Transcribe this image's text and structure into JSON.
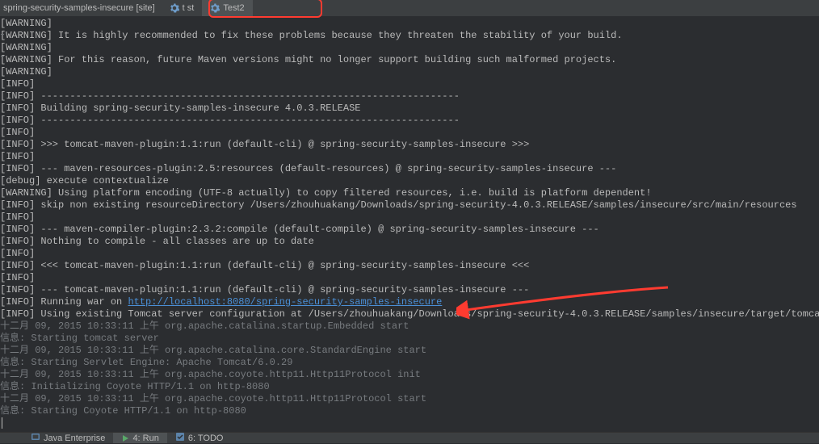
{
  "topbar": {
    "config_label": "spring-security-samples-insecure [site]",
    "tabs": [
      {
        "label": "t st"
      },
      {
        "label": "Test2"
      }
    ]
  },
  "console": {
    "link_url": "http://localhost:8080/spring-security-samples-insecure",
    "lines_before": [
      "[WARNING]",
      "[WARNING] It is highly recommended to fix these problems because they threaten the stability of your build.",
      "[WARNING]",
      "[WARNING] For this reason, future Maven versions might no longer support building such malformed projects.",
      "[WARNING]",
      "[INFO]",
      "[INFO] ------------------------------------------------------------------------",
      "[INFO] Building spring-security-samples-insecure 4.0.3.RELEASE",
      "[INFO] ------------------------------------------------------------------------",
      "[INFO]",
      "[INFO] >>> tomcat-maven-plugin:1.1:run (default-cli) @ spring-security-samples-insecure >>>",
      "[INFO]",
      "[INFO] --- maven-resources-plugin:2.5:resources (default-resources) @ spring-security-samples-insecure ---",
      "[debug] execute contextualize",
      "[WARNING] Using platform encoding (UTF-8 actually) to copy filtered resources, i.e. build is platform dependent!",
      "[INFO] skip non existing resourceDirectory /Users/zhouhuakang/Downloads/spring-security-4.0.3.RELEASE/samples/insecure/src/main/resources",
      "[INFO]",
      "[INFO] --- maven-compiler-plugin:2.3.2:compile (default-compile) @ spring-security-samples-insecure ---",
      "[INFO] Nothing to compile - all classes are up to date",
      "[INFO]",
      "[INFO] <<< tomcat-maven-plugin:1.1:run (default-cli) @ spring-security-samples-insecure <<<",
      "[INFO]",
      "[INFO] --- tomcat-maven-plugin:1.1:run (default-cli) @ spring-security-samples-insecure ---"
    ],
    "link_line_prefix": "[INFO] Running war on ",
    "lines_after": [
      "[INFO] Using existing Tomcat server configuration at /Users/zhouhuakang/Downloads/spring-security-4.0.3.RELEASE/samples/insecure/target/tomcat"
    ],
    "grey_lines": [
      "十二月 09, 2015 10:33:11 上午 org.apache.catalina.startup.Embedded start",
      "信息: Starting tomcat server",
      "十二月 09, 2015 10:33:11 上午 org.apache.catalina.core.StandardEngine start",
      "信息: Starting Servlet Engine: Apache Tomcat/6.0.29",
      "十二月 09, 2015 10:33:11 上午 org.apache.coyote.http11.Http11Protocol init",
      "信息: Initializing Coyote HTTP/1.1 on http-8080",
      "十二月 09, 2015 10:33:11 上午 org.apache.coyote.http11.Http11Protocol start",
      "信息: Starting Coyote HTTP/1.1 on http-8080"
    ]
  },
  "bottombar": {
    "tabs": [
      {
        "label": "Java Enterprise"
      },
      {
        "label": "4: Run"
      },
      {
        "label": "6: TODO"
      }
    ]
  }
}
